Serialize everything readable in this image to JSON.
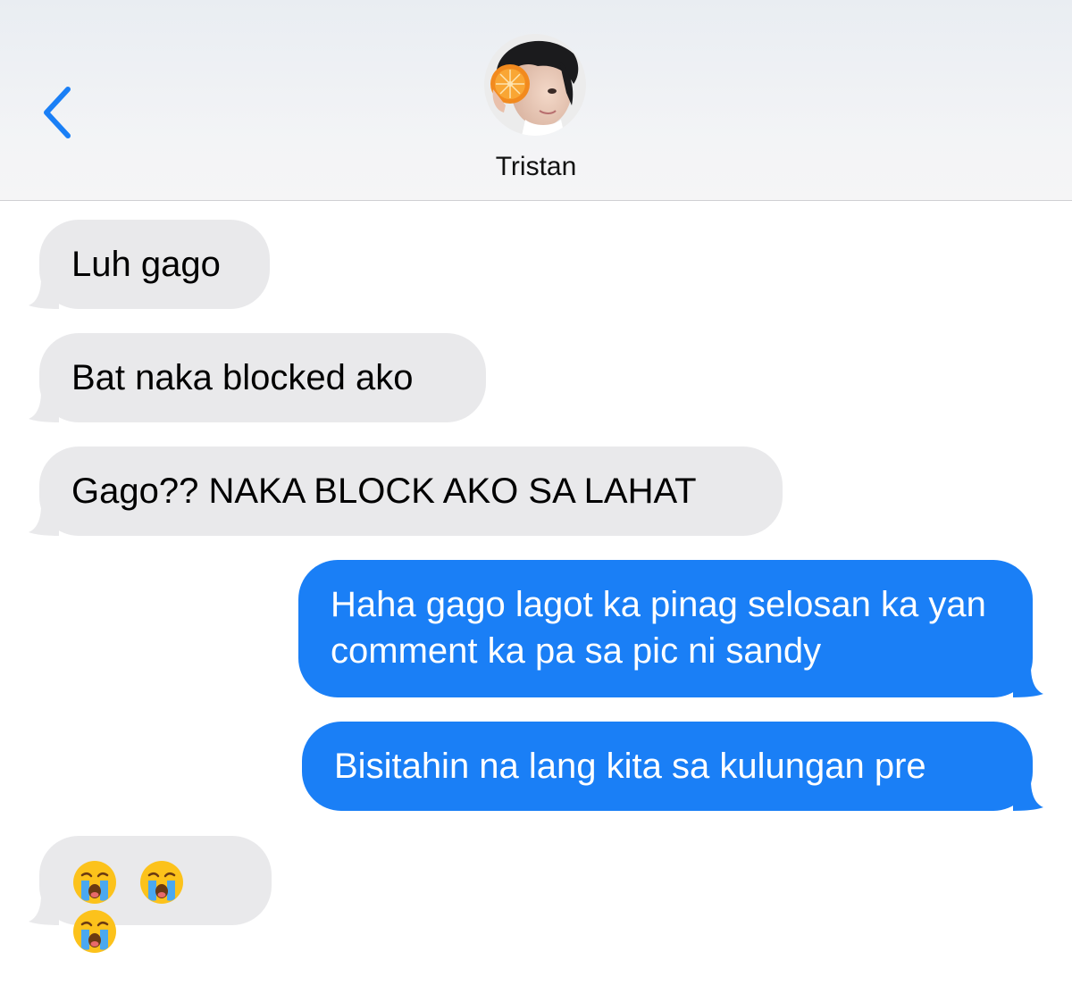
{
  "header": {
    "contact_name": "Tristan",
    "back_icon": "chevron-left-icon",
    "accent_color": "#1a7ff6"
  },
  "messages": [
    {
      "direction": "incoming",
      "text": "Luh gago"
    },
    {
      "direction": "incoming",
      "text": "Bat naka blocked ako"
    },
    {
      "direction": "incoming",
      "text": "Gago?? NAKA BLOCK AKO SA LAHAT"
    },
    {
      "direction": "outgoing",
      "text": "Haha gago lagot ka pinag selosan ka yan comment ka pa sa pic ni sandy"
    },
    {
      "direction": "outgoing",
      "text": "Bisitahin na lang kita sa kulungan pre"
    },
    {
      "direction": "incoming",
      "emoji": [
        "loudly-crying-face",
        "loudly-crying-face",
        "loudly-crying-face"
      ]
    }
  ],
  "colors": {
    "incoming_bubble": "#e9e9eb",
    "outgoing_bubble": "#1a7ff6",
    "outgoing_text": "#ffffff"
  }
}
